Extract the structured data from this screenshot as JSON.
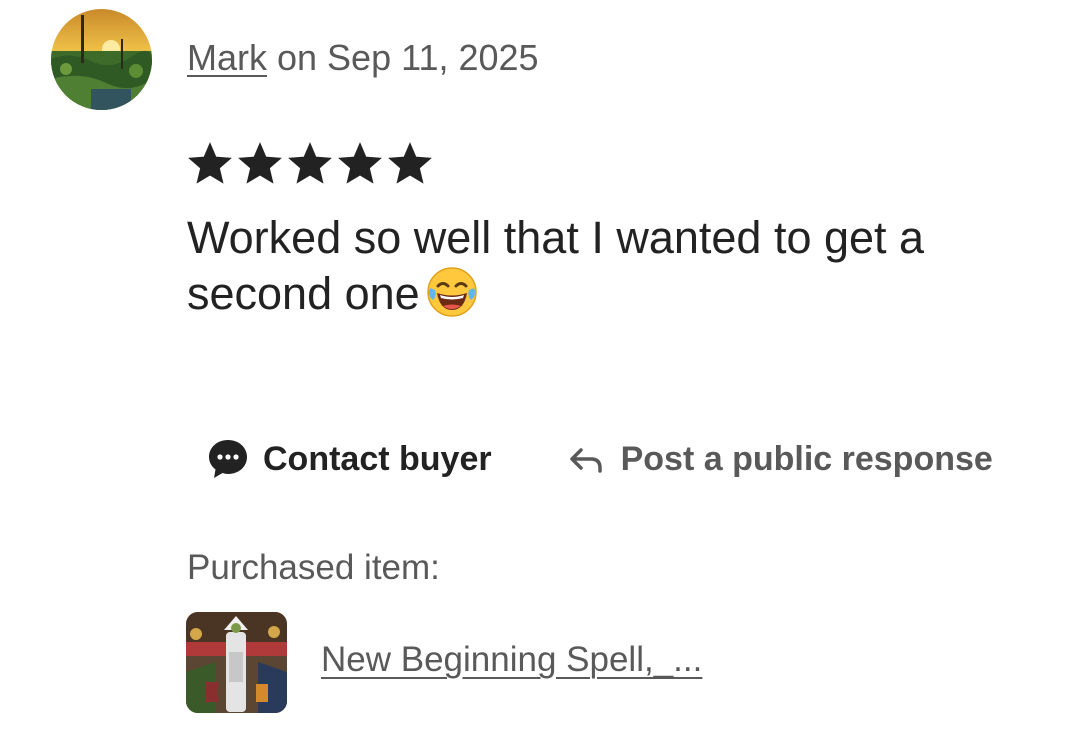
{
  "review": {
    "reviewer_name": "Mark",
    "date_text": " on Sep 11, 2025",
    "rating": 5,
    "rating_max": 5,
    "text": "Worked so well that I wanted to get a second one",
    "emoji_icon": "face-with-tears-of-joy-icon"
  },
  "actions": {
    "contact_label": "Contact buyer",
    "respond_label": "Post a public response"
  },
  "purchase": {
    "label": "Purchased item:",
    "item_title": "New Beginning Spell,_..."
  },
  "colors": {
    "primary_text": "#222222",
    "secondary_text": "#595959",
    "star": "#222222"
  }
}
